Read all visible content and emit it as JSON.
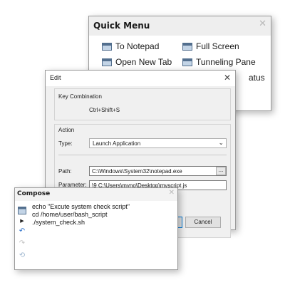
{
  "quick_menu": {
    "title": "Quick Menu",
    "items": [
      {
        "label": "To Notepad",
        "icon": "window-icon"
      },
      {
        "label": "Full Screen",
        "icon": "window-icon"
      },
      {
        "label": "Open New Tab",
        "icon": "window-icon"
      },
      {
        "label": "Tunneling Pane",
        "icon": "window-icon"
      },
      {
        "label": "atus",
        "icon": ""
      }
    ]
  },
  "edit_dialog": {
    "title": "Edit",
    "key_group": {
      "label": "Key Combination",
      "value": "Ctrl+Shift+S"
    },
    "action_group": {
      "label": "Action",
      "type_label": "Type:",
      "type_value": "Launch Application",
      "path_label": "Path:",
      "path_value": "C:\\Windows\\System32\\notepad.exe",
      "browse_label": "...",
      "parameter_label": "Parameter:",
      "parameter_value": "\\9 C:\\Users\\myno\\Desktop\\myscript.js"
    },
    "cancel_label": "Cancel"
  },
  "compose": {
    "title": "Compose",
    "lines": [
      "echo \"Excute system check script\"",
      "cd /home/user/bash_script",
      "./system_check.sh"
    ]
  }
}
